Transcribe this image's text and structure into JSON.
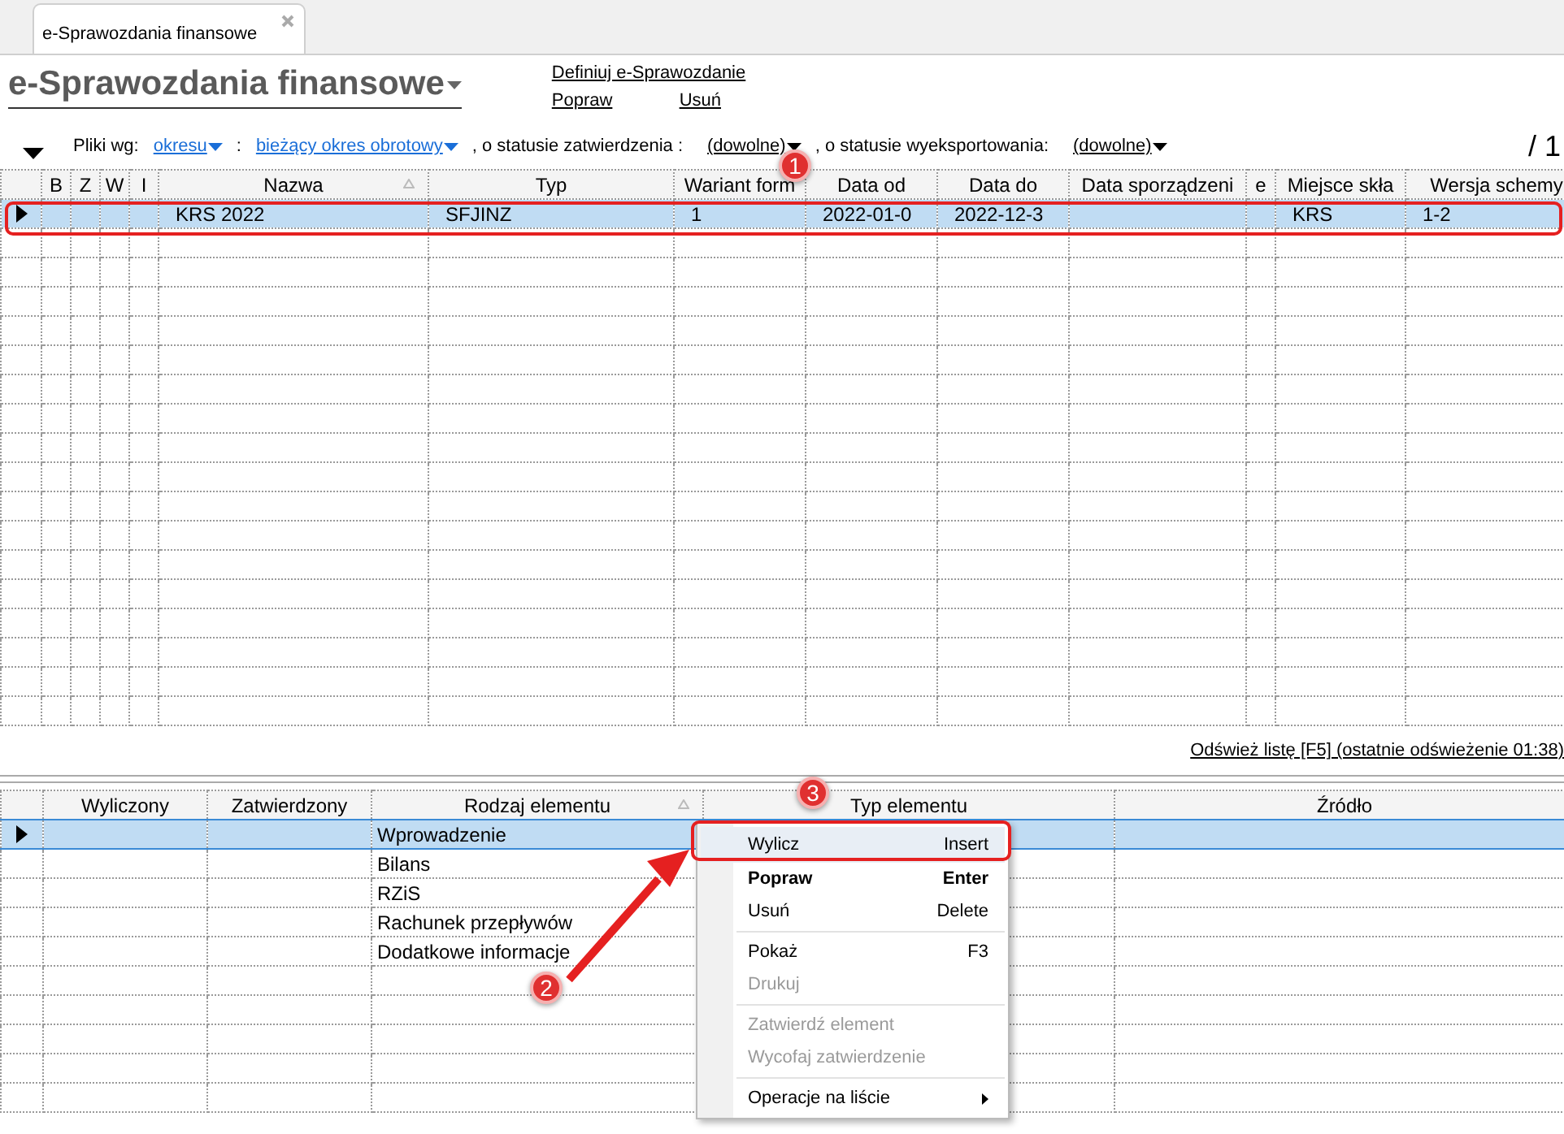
{
  "tab": {
    "label": "e-Sprawozdania finansowe",
    "selected": true
  },
  "header": {
    "title": "e-Sprawozdania finansowe",
    "links": [
      "Definiuj e-Sprawozdanie",
      "Popraw",
      "Usuń"
    ]
  },
  "filter": {
    "parts": [
      {
        "kind": "label",
        "text": "Pliki wg:"
      },
      {
        "kind": "link-dropdown",
        "text": "okresu"
      },
      {
        "kind": "label",
        "text": ":"
      },
      {
        "kind": "link-dropdown",
        "text": "bieżący okres obrotowy"
      },
      {
        "kind": "label",
        "text": ", o statusie zatwierdzenia :"
      },
      {
        "kind": "dropdown",
        "text": "(dowolne)"
      },
      {
        "kind": "label",
        "text": ", o statusie wyeksportowania:"
      },
      {
        "kind": "dropdown",
        "text": "(dowolne)"
      }
    ],
    "page": "/ 1"
  },
  "files_table": {
    "columns": [
      {
        "label": "B",
        "sorted": false
      },
      {
        "label": "Z",
        "sorted": false
      },
      {
        "label": "W",
        "sorted": false
      },
      {
        "label": "I",
        "sorted": false
      },
      {
        "label": "Nazwa",
        "sorted": true
      },
      {
        "label": "Typ",
        "sorted": false
      },
      {
        "label": "Wariant form",
        "sorted": false
      },
      {
        "label": "Data od",
        "sorted": false
      },
      {
        "label": "Data do",
        "sorted": false
      },
      {
        "label": "Data sporządzeni",
        "sorted": false
      },
      {
        "label": "e",
        "sorted": false
      },
      {
        "label": "Miejsce skła",
        "sorted": false
      },
      {
        "label": "Wersja schemy",
        "sorted": false
      }
    ],
    "rows": [
      {
        "selected": true,
        "cells": [
          null,
          null,
          null,
          null,
          "KRS 2022",
          "SFJINZ",
          "1",
          "2022-01-0",
          "2022-12-3",
          null,
          null,
          "KRS",
          "1-2"
        ]
      }
    ]
  },
  "refresh_link": "Odśwież listę [F5] (ostatnie odświeżenie 01:38)",
  "elements_table": {
    "columns": [
      {
        "label": "Wyliczony",
        "sorted": false
      },
      {
        "label": "Zatwierdzony",
        "sorted": false
      },
      {
        "label": "Rodzaj elementu",
        "sorted": true
      },
      {
        "label": "Typ elementu",
        "sorted": false
      },
      {
        "label": "Źródło",
        "sorted": false
      }
    ],
    "rows": [
      {
        "selected": true,
        "cells": [
          null,
          null,
          "Wprowadzenie",
          null,
          null
        ]
      },
      {
        "selected": false,
        "cells": [
          null,
          null,
          "Bilans",
          null,
          null
        ]
      },
      {
        "selected": false,
        "cells": [
          null,
          null,
          "RZiS",
          null,
          null
        ]
      },
      {
        "selected": false,
        "cells": [
          null,
          null,
          "Rachunek przepływów",
          null,
          null
        ]
      },
      {
        "selected": false,
        "cells": [
          null,
          null,
          "Dodatkowe informacje",
          null,
          null
        ]
      }
    ]
  },
  "context_menu": {
    "items": [
      {
        "kind": "item",
        "label": "Wylicz",
        "shortcut": "Insert",
        "bold": false,
        "disabled": false,
        "highlighted": true
      },
      {
        "kind": "item",
        "label": "Popraw",
        "shortcut": "Enter",
        "bold": true,
        "disabled": false,
        "highlighted": false
      },
      {
        "kind": "item",
        "label": "Usuń",
        "shortcut": "Delete",
        "bold": false,
        "disabled": false,
        "highlighted": false
      },
      {
        "kind": "separator"
      },
      {
        "kind": "item",
        "label": "Pokaż",
        "shortcut": "F3",
        "bold": false,
        "disabled": false,
        "highlighted": false
      },
      {
        "kind": "item",
        "label": "Drukuj",
        "bold": false,
        "disabled": true,
        "highlighted": false
      },
      {
        "kind": "separator"
      },
      {
        "kind": "item",
        "label": "Zatwierdź element",
        "bold": false,
        "disabled": true,
        "highlighted": false
      },
      {
        "kind": "item",
        "label": "Wycofaj zatwierdzenie",
        "bold": false,
        "disabled": true,
        "highlighted": false
      },
      {
        "kind": "separator"
      },
      {
        "kind": "submenu",
        "label": "Operacje na liście",
        "bold": false,
        "disabled": false,
        "highlighted": false
      }
    ]
  },
  "annotations": [
    {
      "number": "1"
    },
    {
      "number": "2"
    },
    {
      "number": "3"
    }
  ]
}
